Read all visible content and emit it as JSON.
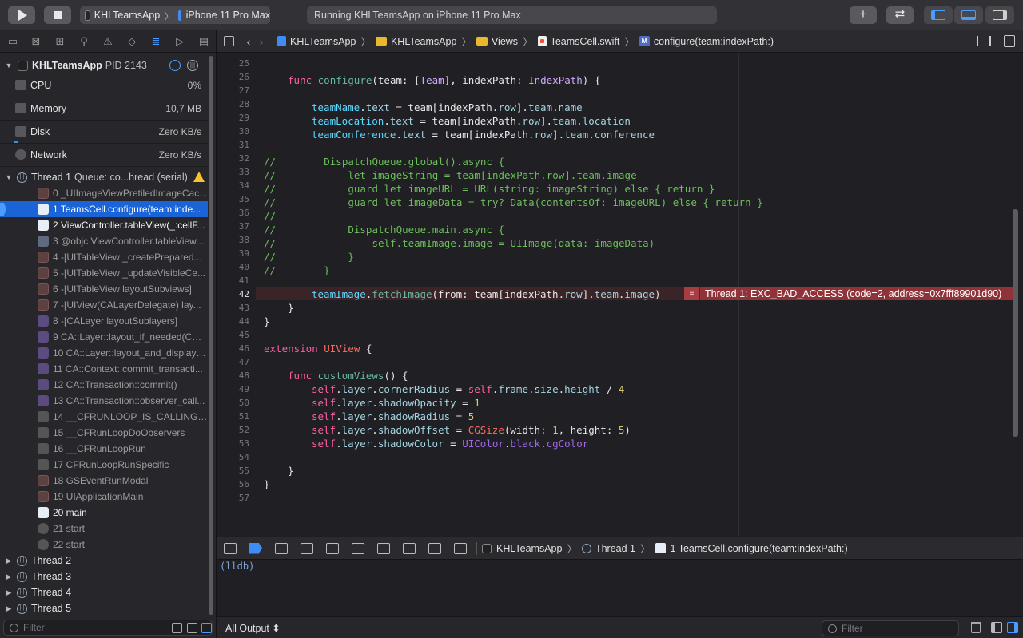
{
  "toolbar": {
    "scheme_app": "KHLTeamsApp",
    "scheme_device": "iPhone 11 Pro Max",
    "activity_status": "Running KHLTeamsApp on iPhone 11 Pro Max",
    "add_label": "+",
    "swap_label": "⇄"
  },
  "navigator": {
    "process_name": "KHLTeamsApp",
    "process_pid": "PID 2143",
    "gauges": [
      {
        "label": "CPU",
        "value": "0%",
        "level_fraction": 0.0
      },
      {
        "label": "Memory",
        "value": "10,7 MB",
        "level_fraction": 0.0
      },
      {
        "label": "Disk",
        "value": "Zero KB/s",
        "level_fraction": 0.02
      },
      {
        "label": "Network",
        "value": "Zero KB/s",
        "level_fraction": 0.0
      }
    ],
    "thread1": {
      "name": "Thread 1",
      "queue": "Queue: co...hread (serial)"
    },
    "frames": [
      "0 _UIImageViewPretiledImageCac...",
      "1 TeamsCell.configure(team:inde...",
      "2 ViewController.tableView(_:cellF...",
      "3 @objc ViewController.tableView...",
      "4 -[UITableView _createPrepared...",
      "5 -[UITableView _updateVisibleCe...",
      "6 -[UITableView layoutSubviews]",
      "7 -[UIView(CALayerDelegate) lay...",
      "8 -[CALayer layoutSublayers]",
      "9 CA::Layer::layout_if_needed(CA:...",
      "10 CA::Layer::layout_and_display_...",
      "11 CA::Context::commit_transacti...",
      "12 CA::Transaction::commit()",
      "13 CA::Transaction::observer_call...",
      "14 __CFRUNLOOP_IS_CALLING_O...",
      "15 __CFRunLoopDoObservers",
      "16 __CFRunLoopRun",
      "17 CFRunLoopRunSpecific",
      "18 GSEventRunModal",
      "19 UIApplicationMain",
      "20 main",
      "21 start",
      "22 start"
    ],
    "other_threads": [
      "Thread 2",
      "Thread 3",
      "Thread 4",
      "Thread 5"
    ],
    "filter_placeholder": "Filter"
  },
  "jumpbar": {
    "crumbs": [
      "KHLTeamsApp",
      "KHLTeamsApp",
      "Views",
      "TeamsCell.swift",
      "configure(team:indexPath:)"
    ],
    "method_badge": "M"
  },
  "editor": {
    "line_numbers": [
      "25",
      "26",
      "27",
      "28",
      "29",
      "30",
      "31",
      "32",
      "33",
      "34",
      "35",
      "36",
      "37",
      "38",
      "39",
      "40",
      "41",
      "42",
      "43",
      "44",
      "45",
      "46",
      "47",
      "48",
      "49",
      "50",
      "51",
      "52",
      "53",
      "54",
      "55",
      "56",
      "57"
    ],
    "current_line": "42",
    "error_message": "Thread 1: EXC_BAD_ACCESS (code=2, address=0x7fff89901d90)",
    "error_icon": "≡",
    "code": {
      "l26_k": "func",
      "l26_fn": "configure",
      "l26_a": "(team: [",
      "l26_t1": "Team",
      "l26_b": "], indexPath: ",
      "l26_t2": "IndexPath",
      "l26_c": ") {",
      "l28_p": "teamName",
      "l28_a": ".",
      "l28_q": "text",
      "l28_b": " = team[indexPath.",
      "l28_r": "row",
      "l28_c": "].",
      "l28_s": "team",
      "l28_d": ".",
      "l28_e": "name",
      "l29_p": "teamLocation",
      "l29_a": ".",
      "l29_q": "text",
      "l29_b": " = team[indexPath.",
      "l29_r": "row",
      "l29_c": "].",
      "l29_s": "team",
      "l29_d": ".",
      "l29_e": "location",
      "l30_p": "teamConference",
      "l30_a": ".",
      "l30_q": "text",
      "l30_b": " = team[indexPath.",
      "l30_r": "row",
      "l30_c": "].",
      "l30_s": "team",
      "l30_d": ".",
      "l30_e": "conference",
      "l32": "//        DispatchQueue.global().async {",
      "l33": "//            let imageString = team[indexPath.row].team.image",
      "l34": "//            guard let imageURL = URL(string: imageString) else { return }",
      "l35": "//            guard let imageData = try? Data(contentsOf: imageURL) else { return }",
      "l36": "//",
      "l37": "//            DispatchQueue.main.async {",
      "l38": "//                self.teamImage.image = UIImage(data: imageData)",
      "l39": "//            }",
      "l40": "//        }",
      "l42_p": "teamImage",
      "l42_a": ".",
      "l42_f": "fetchImage",
      "l42_b": "(from: team[indexPath.",
      "l42_r": "row",
      "l42_c": "].",
      "l42_s": "team",
      "l42_d": ".",
      "l42_e": "image",
      "l42_g": ")",
      "l43": "}",
      "l44": "}",
      "l46_k": "extension",
      "l46_t": "UIView",
      "l46_a": " {",
      "l48_k": "func",
      "l48_fn": "customViews",
      "l48_a": "() {",
      "l49_s": "self",
      "l49_a": ".",
      "l49_p": "layer",
      "l49_b": ".",
      "l49_q": "cornerRadius",
      "l49_c": " = ",
      "l49_s2": "self",
      "l49_d": ".",
      "l49_p2": "frame",
      "l49_e": ".",
      "l49_p3": "size",
      "l49_f": ".",
      "l49_p4": "height",
      "l49_g": " / ",
      "l49_n": "4",
      "l50_s": "self",
      "l50_a": ".",
      "l50_p": "layer",
      "l50_b": ".",
      "l50_q": "shadowOpacity",
      "l50_c": " = ",
      "l50_n": "1",
      "l51_s": "self",
      "l51_a": ".",
      "l51_p": "layer",
      "l51_b": ".",
      "l51_q": "shadowRadius",
      "l51_c": " = ",
      "l51_n": "5",
      "l52_s": "self",
      "l52_a": ".",
      "l52_p": "layer",
      "l52_b": ".",
      "l52_q": "shadowOffset",
      "l52_c": " = ",
      "l52_t": "CGSize",
      "l52_d": "(width: ",
      "l52_n1": "1",
      "l52_e": ", height: ",
      "l52_n2": "5",
      "l52_f": ")",
      "l53_s": "self",
      "l53_a": ".",
      "l53_p": "layer",
      "l53_b": ".",
      "l53_q": "shadowColor",
      "l53_c": " = ",
      "l53_t": "UIColor",
      "l53_d": ".",
      "l53_e": "black",
      "l53_f": ".",
      "l53_g": "cgColor",
      "l55": "}",
      "l56": "}"
    }
  },
  "debugbar": {
    "crumb_app": "KHLTeamsApp",
    "crumb_thread": "Thread 1",
    "crumb_frame": "1 TeamsCell.configure(team:indexPath:)"
  },
  "console": {
    "prompt": "(lldb)",
    "output_select": "All Output ⬍",
    "filter_placeholder": "Filter"
  },
  "colors": {
    "accent": "#3f8cf5",
    "error": "#8f3338",
    "keyword": "#fc5fa3",
    "comment": "#6bbf59"
  }
}
